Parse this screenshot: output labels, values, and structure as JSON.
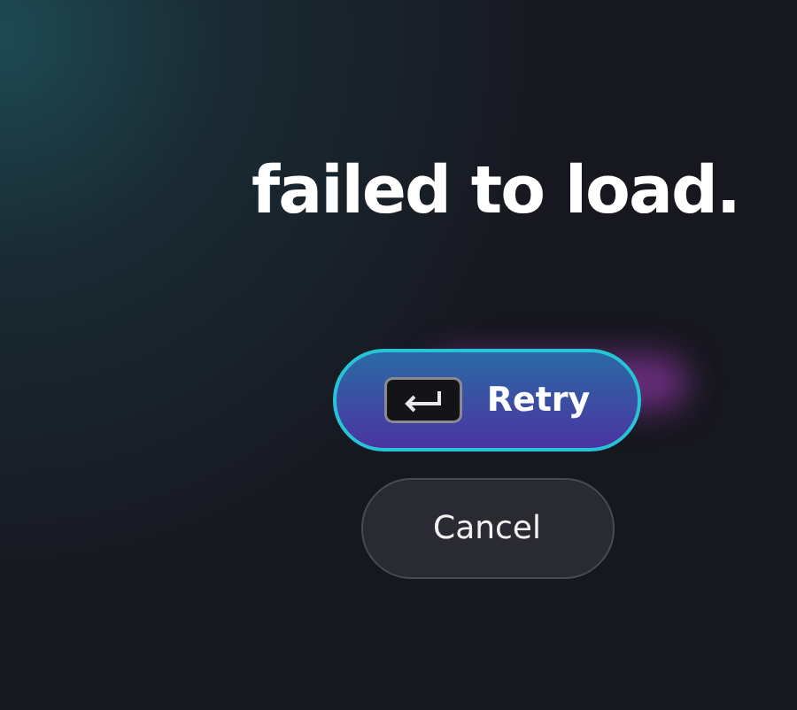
{
  "message": {
    "heading": "failed to load."
  },
  "actions": [
    {
      "kind": "primary",
      "label": "Retry"
    },
    {
      "kind": "secondary",
      "label": "Cancel"
    }
  ]
}
